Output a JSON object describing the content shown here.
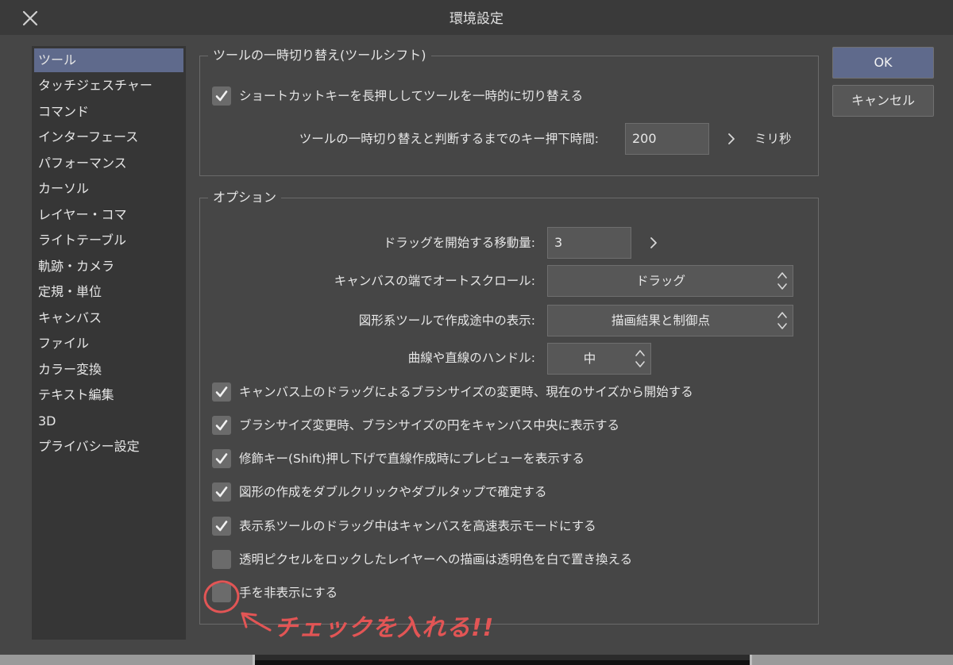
{
  "window": {
    "title": "環境設定"
  },
  "icons": {
    "close": "close-icon",
    "check": "check-icon",
    "chevron": "chevron-right-icon",
    "updown": "updown-chevron-icon"
  },
  "colors": {
    "accent": "#5f6a8c",
    "annotation": "#e25555",
    "panel": "#464646"
  },
  "sidebar": {
    "items": [
      {
        "label": "ツール",
        "active": true
      },
      {
        "label": "タッチジェスチャー"
      },
      {
        "label": "コマンド"
      },
      {
        "label": "インターフェース"
      },
      {
        "label": "パフォーマンス"
      },
      {
        "label": "カーソル"
      },
      {
        "label": "レイヤー・コマ"
      },
      {
        "label": "ライトテーブル"
      },
      {
        "label": "軌跡・カメラ"
      },
      {
        "label": "定規・単位"
      },
      {
        "label": "キャンバス"
      },
      {
        "label": "ファイル"
      },
      {
        "label": "カラー変換"
      },
      {
        "label": "テキスト編集"
      },
      {
        "label": "3D"
      },
      {
        "label": "プライバシー設定"
      }
    ]
  },
  "toolshift": {
    "legend": "ツールの一時切り替え(ツールシフト)",
    "checkbox": {
      "label": "ショートカットキーを長押ししてツールを一時的に切り替える",
      "checked": true
    },
    "hold_time": {
      "label": "ツールの一時切り替えと判断するまでのキー押下時間:",
      "value": "200",
      "unit": "ミリ秒"
    }
  },
  "options": {
    "legend": "オプション",
    "drag_amount": {
      "label": "ドラッグを開始する移動量:",
      "value": "3"
    },
    "autoscroll": {
      "label": "キャンバスの端でオートスクロール:",
      "value": "ドラッグ"
    },
    "shape_display": {
      "label": "図形系ツールで作成途中の表示:",
      "value": "描画結果と制御点"
    },
    "handle": {
      "label": "曲線や直線のハンドル:",
      "value": "中"
    },
    "checkboxes": [
      {
        "label": "キャンバス上のドラッグによるブラシサイズの変更時、現在のサイズから開始する",
        "checked": true
      },
      {
        "label": "ブラシサイズ変更時、ブラシサイズの円をキャンバス中央に表示する",
        "checked": true
      },
      {
        "label": "修飾キー(Shift)押し下げで直線作成時にプレビューを表示する",
        "checked": true
      },
      {
        "label": "図形の作成をダブルクリックやダブルタップで確定する",
        "checked": true
      },
      {
        "label": "表示系ツールのドラッグ中はキャンバスを高速表示モードにする",
        "checked": true
      },
      {
        "label": "透明ピクセルをロックしたレイヤーへの描画は透明色を白で置き換える",
        "checked": false
      },
      {
        "label": "手を非表示にする",
        "checked": false
      }
    ]
  },
  "buttons": {
    "ok": "OK",
    "cancel": "キャンセル"
  },
  "annotation": {
    "text": "チェックを入れる!!"
  }
}
